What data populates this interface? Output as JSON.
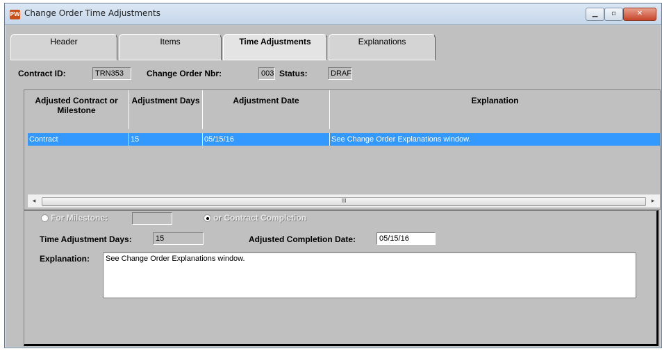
{
  "window": {
    "title": "Change Order Time Adjustments",
    "icon": "PW"
  },
  "titlebar_controls": {
    "minimize": "▁",
    "maximize": "▫",
    "close": "✕"
  },
  "tabs": [
    {
      "label": "Header"
    },
    {
      "label": "Items"
    },
    {
      "label": "Time Adjustments"
    },
    {
      "label": "Explanations"
    }
  ],
  "info": {
    "contract_id_label": "Contract ID:",
    "contract_id_value": "TRN353",
    "change_order_label": "Change Order Nbr:",
    "change_order_value": "003",
    "status_label": "Status:",
    "status_value": "DRAF"
  },
  "grid": {
    "columns": [
      "Adjusted Contract or Milestone",
      "Adjustment Days",
      "Adjustment Date",
      "Explanation"
    ],
    "rows": [
      {
        "milestone": "Contract",
        "days": "15",
        "date": "05/15/16",
        "explanation": "See Change Order Explanations window."
      }
    ],
    "scroll_thumb": "III",
    "scroll_left": "◂",
    "scroll_right": "▸"
  },
  "detail": {
    "milestone_radio_label": "For Milestone:",
    "milestone_value": "",
    "contract_radio_label": "or Contract Completion",
    "time_days_label": "Time Adjustment Days:",
    "time_days_value": "15",
    "adjusted_date_label": "Adjusted Completion Date:",
    "adjusted_date_value": "05/15/16",
    "explanation_label": "Explanation:",
    "explanation_value": "See Change Order Explanations window."
  }
}
